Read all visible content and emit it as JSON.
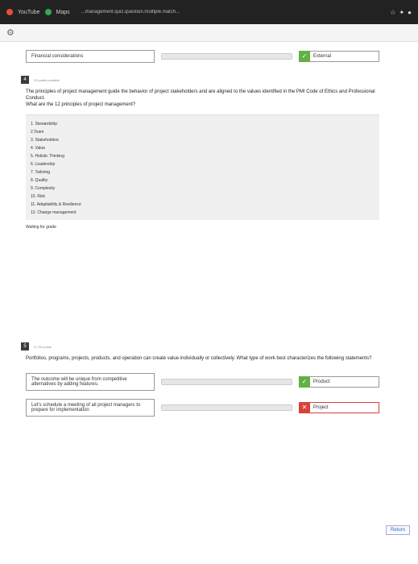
{
  "browser": {
    "tab_label": "YouTube",
    "tab2_label": "Maps",
    "url": "...management.quiz.question.multiple.match...",
    "icons": [
      "star-icon",
      "extension-icon",
      "profile-icon"
    ]
  },
  "q3_tail": {
    "left_text": "Financial considerations",
    "answer": "External",
    "answer_status": "correct"
  },
  "q4": {
    "number": "4",
    "points": "20 points possible",
    "question_line1": "The principles of project management guide the behavior of project stakeholders and are aligned to the values identified in the PMI Code of Ethics and Professional Conduct.",
    "question_line2": "What are the 12 principles of project management?",
    "items": [
      "1. Stewardship",
      "2.Team",
      "3. Stakeholders",
      "4. Value",
      "5. Holistic Thinking",
      "6. Leadership",
      "7. Tailoring",
      "8. Quality",
      "9. Complexity",
      "10. Risk",
      "11. Adaptability & Resilience",
      "12. Change management"
    ],
    "status": "Waiting for grade"
  },
  "q5": {
    "number": "5",
    "points": "0 / 20 points",
    "question": "Portfolios, programs, projects, products, and operation can create value individually or collectively. What type of work best characterizes the following statements?",
    "rows": [
      {
        "left": "The outcome will be unique from competitive alternatives by adding features.",
        "answer": "Product",
        "status": "correct"
      },
      {
        "left": "Let's schedule a meeting of all project managers to prepare for implementation",
        "answer": "Project",
        "status": "incorrect"
      }
    ]
  },
  "footer": {
    "return_label": "Return"
  },
  "colors": {
    "correct": "#61b144",
    "incorrect": "#d9413a"
  }
}
